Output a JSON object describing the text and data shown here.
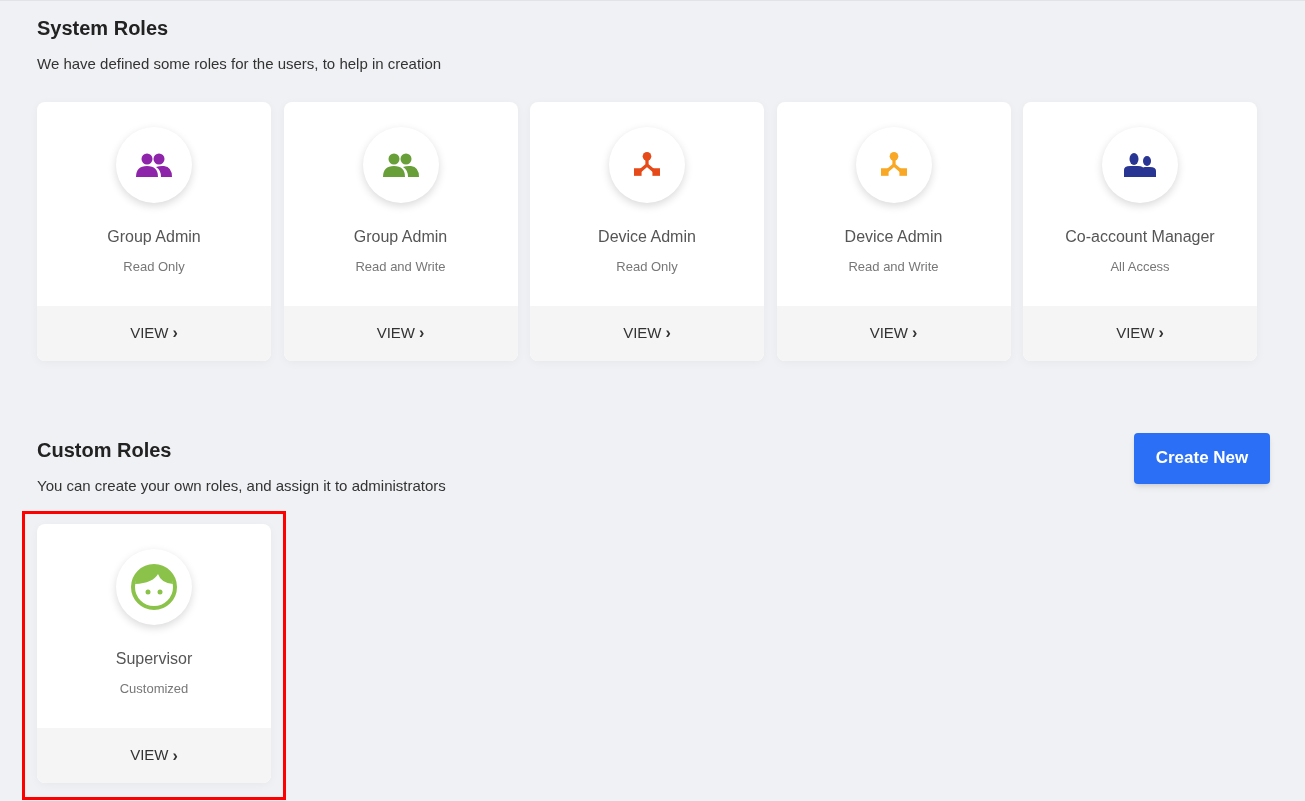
{
  "system_roles": {
    "title": "System Roles",
    "description": "We have defined some roles for the users, to help in creation",
    "cards": [
      {
        "kind": "group",
        "color": "#8e24aa",
        "name": "Group Admin",
        "access": "Read Only",
        "action": "VIEW",
        "action_icon": "›"
      },
      {
        "kind": "group",
        "color": "#689f38",
        "name": "Group Admin",
        "access": "Read and Write",
        "action": "VIEW",
        "action_icon": "›"
      },
      {
        "kind": "hierarchy",
        "color": "#e64a19",
        "name": "Device Admin",
        "access": "Read Only",
        "action": "VIEW",
        "action_icon": "›"
      },
      {
        "kind": "hierarchy",
        "color": "#f9a825",
        "name": "Device Admin",
        "access": "Read and Write",
        "action": "VIEW",
        "action_icon": "›"
      },
      {
        "kind": "managers",
        "color": "#283593",
        "name": "Co-account Manager",
        "access": "All Access",
        "action": "VIEW",
        "action_icon": "›"
      }
    ]
  },
  "custom_roles": {
    "title": "Custom Roles",
    "description": "You can create your own roles, and assign it to administrators",
    "create_button": "Create New",
    "cards": [
      {
        "kind": "face",
        "color": "#8bc34a",
        "name": "Supervisor",
        "access": "Customized",
        "action": "VIEW",
        "action_icon": "›",
        "highlighted": true
      }
    ]
  }
}
